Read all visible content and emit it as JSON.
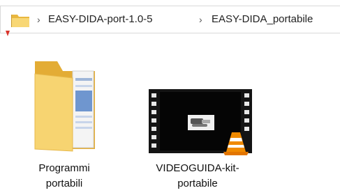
{
  "breadcrumb": {
    "separator": "›",
    "crumbs": [
      {
        "label": "EASY-DIDA-port-1.0-5"
      },
      {
        "label": "EASY-DIDA_portabile"
      }
    ]
  },
  "items": [
    {
      "name_line1": "Programmi",
      "name_line2": "portabili",
      "type": "folder",
      "icon": "folder-with-documents-icon"
    },
    {
      "name_line1": "VIDEOGUIDA-kit-",
      "name_line2": "portabile",
      "type": "video",
      "icon": "vlc-video-icon"
    }
  ],
  "colors": {
    "folder_back": "#e8b84a",
    "folder_front": "#f7d774",
    "vlc_orange": "#f08a00",
    "accent_red": "#d9342b"
  }
}
